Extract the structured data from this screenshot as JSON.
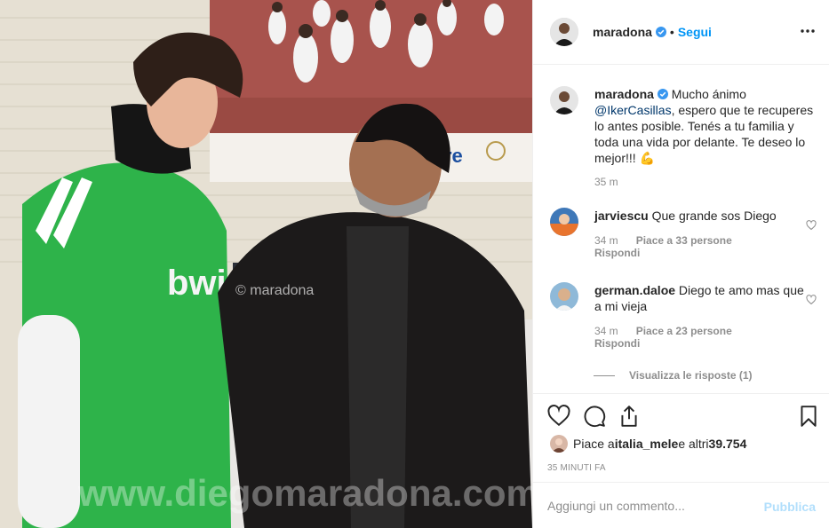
{
  "photo": {
    "banner_text": "re",
    "watermark_small": "© maradona",
    "watermark_large": "www.diegomaradona.com",
    "jersey_text": "bwin"
  },
  "post": {
    "username": "maradona",
    "follow_label": "Segui",
    "separator": "•"
  },
  "caption": {
    "username": "maradona",
    "text_before": " Mucho ánimo ",
    "mention": "@IkerCasillas",
    "text_after": ", espero que te recuperes lo antes posible. Tenés a tu familia y toda una vida por delante. Te deseo lo mejor!!! ",
    "emoji": "💪",
    "time": "35 m"
  },
  "comments": [
    {
      "username": "jarviescu",
      "text": " Que grande sos Diego",
      "time": "34 m",
      "likes": "Piace a 33 persone",
      "reply": "Rispondi"
    },
    {
      "username": "german.daloe",
      "text": " Diego te amo mas que a mi vieja",
      "time": "34 m",
      "likes": "Piace a 23 persone",
      "reply": "Rispondi"
    }
  ],
  "view_replies": "Visualizza le risposte (1)",
  "likes_summary": {
    "prefix": "Piace a ",
    "user": "italia_mele",
    "suffix": " e altri ",
    "count": "39.754"
  },
  "time_ago": "35 MINUTI FA",
  "add_comment": {
    "placeholder": "Aggiungi un commento...",
    "publish": "Pubblica"
  },
  "colors": {
    "link_blue": "#0095f6",
    "publish_disabled": "#b2dffc",
    "secondary_text": "#8e8e8e"
  }
}
